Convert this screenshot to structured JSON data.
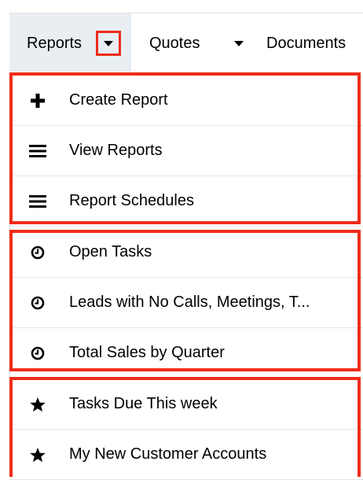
{
  "nav": {
    "items": [
      {
        "label": "Reports"
      },
      {
        "label": "Quotes"
      },
      {
        "label": "Documents"
      }
    ]
  },
  "menu": {
    "items": [
      {
        "label": "Create Report",
        "icon": "plus-icon"
      },
      {
        "label": "View Reports",
        "icon": "list-icon"
      },
      {
        "label": "Report Schedules",
        "icon": "list-icon"
      },
      {
        "label": "Open Tasks",
        "icon": "clock-icon"
      },
      {
        "label": "Leads with No Calls, Meetings, T...",
        "icon": "clock-icon"
      },
      {
        "label": "Total Sales by Quarter",
        "icon": "clock-icon"
      },
      {
        "label": "Tasks Due This week",
        "icon": "star-icon"
      },
      {
        "label": "My New Customer Accounts",
        "icon": "star-icon"
      }
    ]
  },
  "colors": {
    "highlight": "#ee2c1a",
    "active_tab_bg": "#e9eef3"
  }
}
